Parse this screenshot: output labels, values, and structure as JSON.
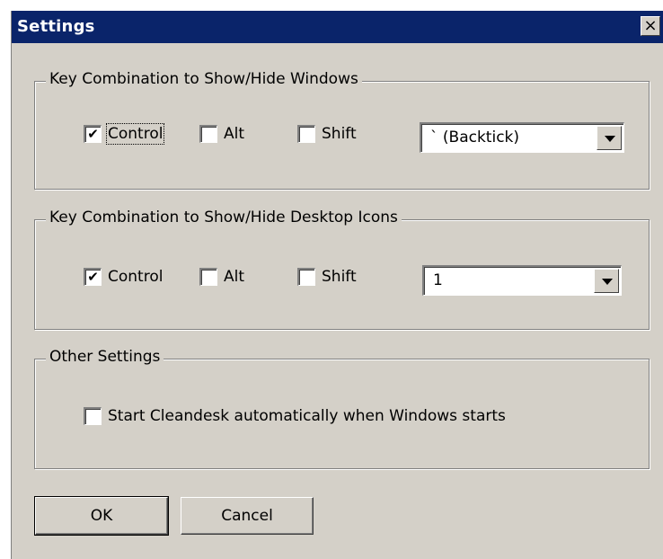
{
  "window": {
    "title": "Settings",
    "close_glyph": "×"
  },
  "groups": [
    {
      "label": "Key Combination to Show/Hide Windows",
      "control": {
        "label": "Control",
        "checked": true
      },
      "alt": {
        "label": "Alt",
        "checked": false
      },
      "shift": {
        "label": "Shift",
        "checked": false
      },
      "key": {
        "value": "` (Backtick)"
      }
    },
    {
      "label": "Key Combination to Show/Hide Desktop Icons",
      "control": {
        "label": "Control",
        "checked": true
      },
      "alt": {
        "label": "Alt",
        "checked": false
      },
      "shift": {
        "label": "Shift",
        "checked": false
      },
      "key": {
        "value": "1"
      }
    },
    {
      "label": "Other Settings",
      "autostart": {
        "label": "Start Cleandesk automatically when Windows starts",
        "checked": false
      }
    }
  ],
  "buttons": {
    "ok": "OK",
    "cancel": "Cancel"
  },
  "colors": {
    "titlebar": "#0a246a",
    "face": "#d4d0c8"
  },
  "icons": {
    "checkmark": "✔",
    "close": "close-icon",
    "dropdown": "chevron-down-icon"
  }
}
